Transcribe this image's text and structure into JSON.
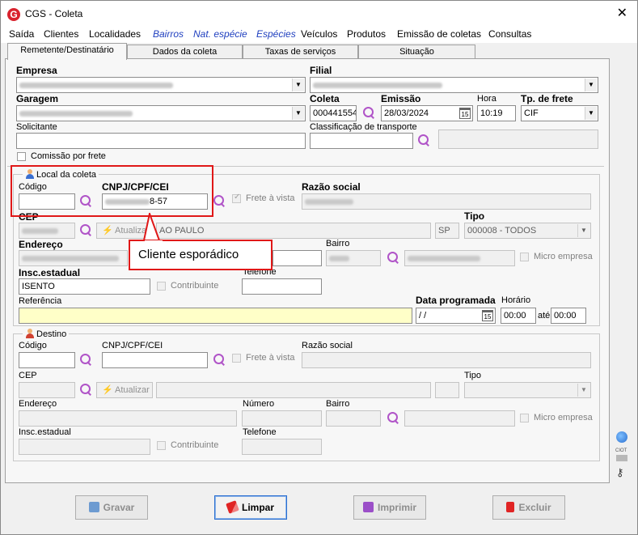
{
  "window": {
    "title": "CGS - Coleta",
    "logo": "G",
    "close_icon": "close-icon"
  },
  "menu": [
    "Saída",
    "Clientes",
    "Localidades",
    "Bairros",
    "Nat. espécie",
    "Espécies",
    "Veículos",
    "Produtos",
    "Emissão de coletas",
    "Consultas"
  ],
  "tabs": [
    "Remetente/Destinatário",
    "Dados da coleta",
    "Taxas de serviços",
    "Situação"
  ],
  "top": {
    "empresa_label": "Empresa",
    "filial_label": "Filial",
    "garagem_label": "Garagem",
    "coleta_label": "Coleta",
    "coleta_value": "000441554",
    "emissao_label": "Emissão",
    "emissao_value": "28/03/2024",
    "hora_label": "Hora",
    "hora_value": "10:19",
    "tp_frete_label": "Tp. de frete",
    "tp_frete_value": "CIF",
    "solicitante_label": "Solicitante",
    "classificacao_label": "Classificação de transporte",
    "comissao_label": "Comissão por frete"
  },
  "local": {
    "group_title": "Local da coleta",
    "codigo_label": "Código",
    "cnpj_label": "CNPJ/CPF/CEI",
    "cnpj_suffix": "8-57",
    "frete_vista_label": "Frete à vista",
    "razao_label": "Razão social",
    "cep_label": "CEP",
    "atualizar_label": "Atualizar",
    "cidade_value": "AO PAULO",
    "uf_value": "SP",
    "tipo_label": "Tipo",
    "tipo_value": "000008 - TODOS",
    "endereco_label": "Endereço",
    "bairro_label": "Bairro",
    "micro_label": "Micro empresa",
    "insc_label": "Insc.estadual",
    "insc_value": "ISENTO",
    "contribuinte_label": "Contribuinte",
    "telefone_label": "Telefone",
    "referencia_label": "Referência",
    "data_prog_label": "Data programada",
    "data_prog_value": " / /",
    "horario_label": "Horário",
    "horario_de": "00:00",
    "ate_label": "até",
    "horario_ate": "00:00"
  },
  "destino": {
    "group_title": "Destino",
    "codigo_label": "Código",
    "cnpj_label": "CNPJ/CPF/CEI",
    "frete_vista_label": "Frete à vista",
    "razao_label": "Razão social",
    "cep_label": "CEP",
    "atualizar_label": "Atualizar",
    "tipo_label": "Tipo",
    "endereco_label": "Endereço",
    "numero_label": "Número",
    "bairro_label": "Bairro",
    "micro_label": "Micro empresa",
    "insc_label": "Insc.estadual",
    "contribuinte_label": "Contribuinte",
    "telefone_label": "Telefone"
  },
  "callout": {
    "text": "Cliente esporádico"
  },
  "side": {
    "ciot_label": "CIOT"
  },
  "buttons": {
    "gravar": "Gravar",
    "limpar": "Limpar",
    "imprimir": "Imprimir",
    "excluir": "Excluir"
  },
  "colors": {
    "annotation_red": "#e01818",
    "menu_blue": "#1f3fbf",
    "search_purple": "#b054c8",
    "reference_yellow": "#ffffc8"
  }
}
